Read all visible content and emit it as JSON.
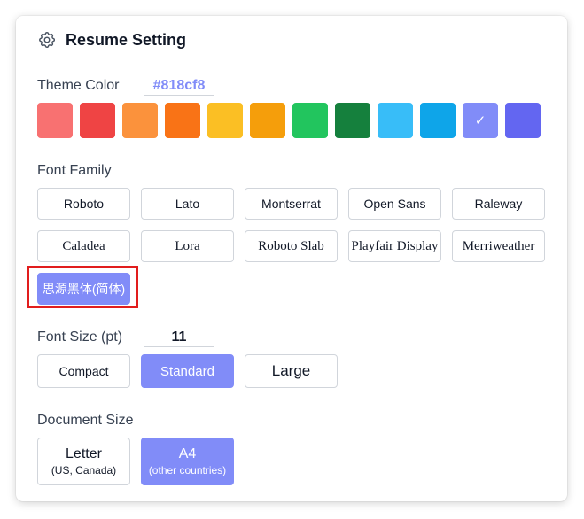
{
  "header": {
    "title": "Resume Setting",
    "icon": "gear-icon"
  },
  "theme": {
    "label": "Theme Color",
    "value": "#818cf8",
    "check": "✓",
    "swatches": [
      "#f87171",
      "#ef4444",
      "#fb923c",
      "#f97316",
      "#fbbf24",
      "#f59e0b",
      "#22c55e",
      "#15803d",
      "#38bdf8",
      "#0ea5e9",
      "#818cf8",
      "#6366f1"
    ],
    "selected_index": 10
  },
  "font_family": {
    "label": "Font Family",
    "options": [
      "Roboto",
      "Lato",
      "Montserrat",
      "Open Sans",
      "Raleway",
      "Caladea",
      "Lora",
      "Roboto Slab",
      "Playfair Display",
      "Merriweather",
      "思源黑体(简体)"
    ],
    "selected": "思源黑体(简体)"
  },
  "font_size": {
    "label": "Font Size (pt)",
    "value": "11",
    "options": [
      "Compact",
      "Standard",
      "Large"
    ],
    "selected": "Standard"
  },
  "document_size": {
    "label": "Document Size",
    "options": [
      {
        "label": "Letter",
        "sub": "(US, Canada)"
      },
      {
        "label": "A4",
        "sub": "(other countries)"
      }
    ],
    "selected": "A4"
  },
  "colors": {
    "accent": "#818cf8",
    "highlight": "#e11d1d"
  }
}
